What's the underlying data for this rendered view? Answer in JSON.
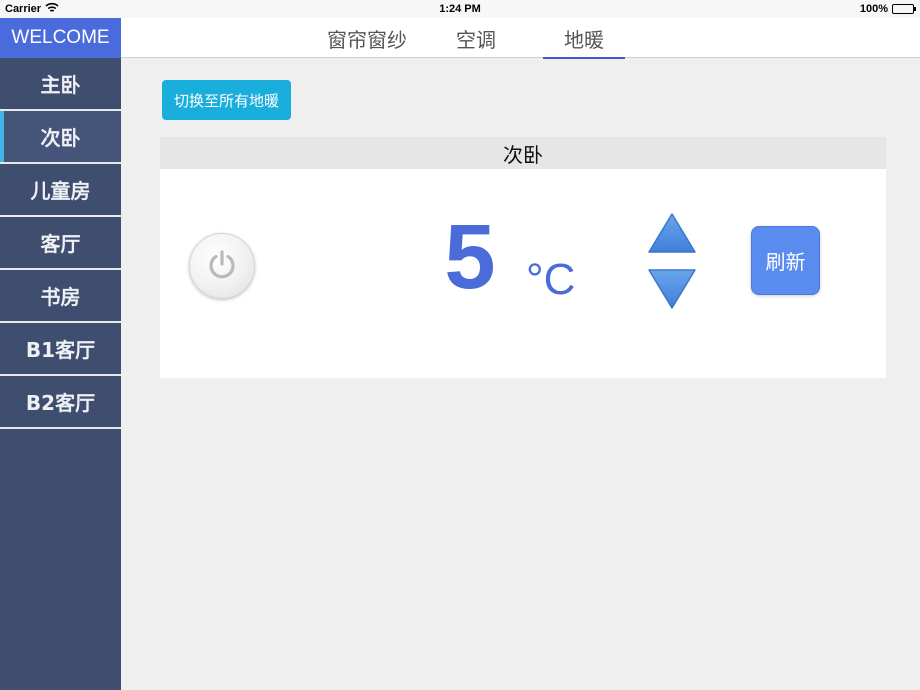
{
  "status_bar": {
    "carrier": "Carrier",
    "time": "1:24 PM",
    "battery": "100%",
    "wifi_icon": "wifi-icon",
    "battery_icon": "battery-icon"
  },
  "sidebar": {
    "welcome": "WELCOME",
    "items": [
      {
        "label": "主卧"
      },
      {
        "label": "次卧",
        "active": true
      },
      {
        "label": "儿童房"
      },
      {
        "label": "客厅"
      },
      {
        "label": "书房"
      },
      {
        "label": "B1客厅"
      },
      {
        "label": "B2客厅"
      }
    ]
  },
  "tabs": [
    {
      "label": "窗帘窗纱"
    },
    {
      "label": "空调"
    },
    {
      "label": "地暖",
      "active": true
    }
  ],
  "switch_button": {
    "label": "切换至所有地暖"
  },
  "panel": {
    "title": "次卧",
    "power_icon": "power-icon",
    "temperature": "5",
    "unit": "°C",
    "up_icon": "triangle-up-icon",
    "down_icon": "triangle-down-icon",
    "refresh_label": "刷新"
  },
  "colors": {
    "sidebar_bg": "#3f4e6e",
    "welcome_bg": "#4a6bdc",
    "active_indicator": "#3fb5e8",
    "switch_button_bg": "#1aaedc",
    "temperature_text": "#4a6bd8",
    "arrow_fill": "#4a8ce0",
    "refresh_button_bg": "#5a8cf0",
    "tab_underline": "#4a52d6"
  }
}
